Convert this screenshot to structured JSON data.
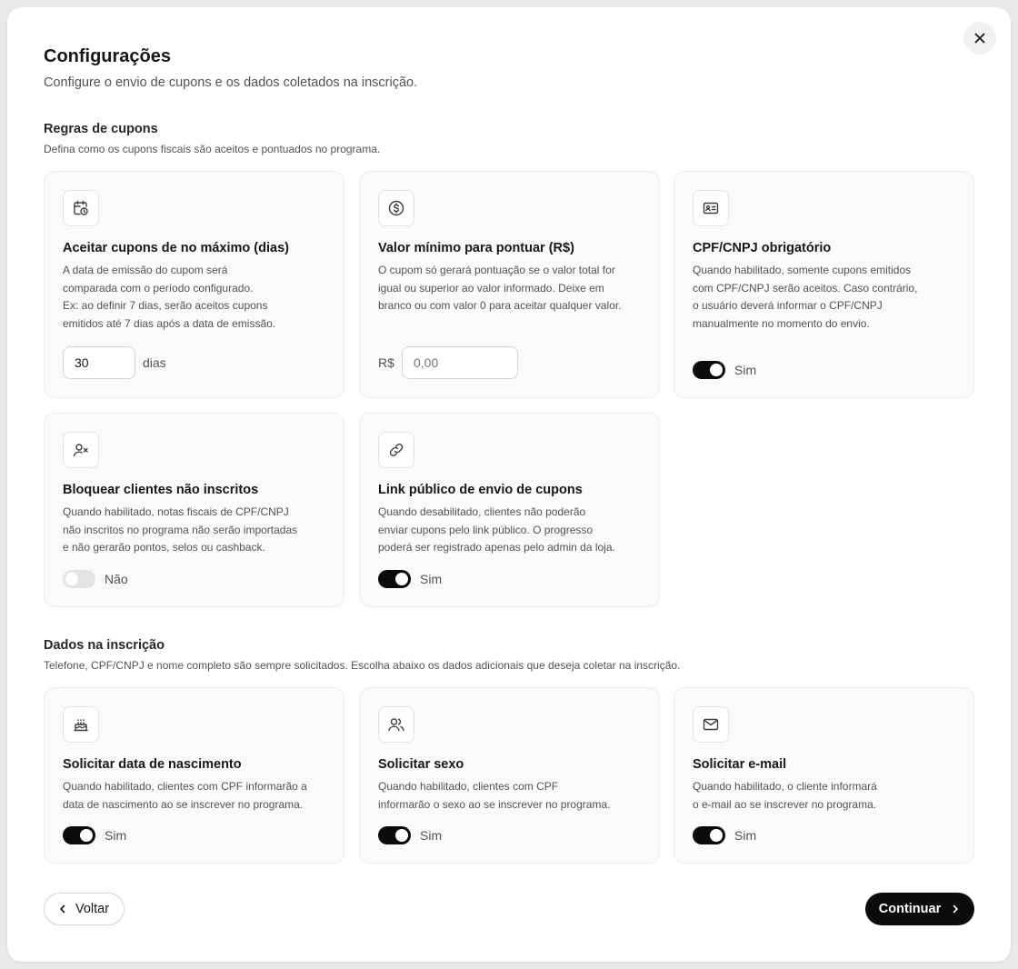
{
  "dialog": {
    "title": "Configurações",
    "subtitle": "Configure o envio de cupons e os dados coletados na inscrição."
  },
  "coupon_rules": {
    "title": "Regras de cupons",
    "description": "Defina como os cupons fiscais são aceitos e pontuados no programa.",
    "max_days": {
      "icon": "calendar-clock-icon",
      "title": "Aceitar cupons de no máximo (dias)",
      "description_lines": [
        "A data de emissão do cupom será",
        "comparada com o período configurado.",
        "Ex: ao definir 7 dias, serão aceitos cupons",
        "emitidos até 7 dias após a data de emissão."
      ],
      "value": "30",
      "unit": "dias"
    },
    "min_value": {
      "icon": "dollar-circle-icon",
      "title": "Valor mínimo para pontuar (R$)",
      "description_lines": [
        "O cupom só gerará pontuação se o valor total for",
        "igual ou superior ao valor informado. Deixe em",
        "branco ou com valor 0 para aceitar qualquer valor."
      ],
      "currency": "R$",
      "placeholder": "0,00"
    },
    "cpf_required": {
      "icon": "id-card-icon",
      "title": "CPF/CNPJ obrigatório",
      "description_lines": [
        "Quando habilitado, somente cupons emitidos",
        "com CPF/CNPJ serão aceitos. Caso contrário,",
        "o usuário deverá informar o CPF/CNPJ",
        "manualmente no momento do envio."
      ],
      "enabled": true,
      "toggle_label": "Sim"
    },
    "block_unregistered": {
      "icon": "user-x-icon",
      "title": "Bloquear clientes não inscritos",
      "description_lines": [
        "Quando habilitado, notas fiscais de CPF/CNPJ",
        "não inscritos no programa não serão importadas",
        "e não gerarão pontos, selos ou cashback."
      ],
      "enabled": false,
      "toggle_label": "Não"
    },
    "public_link": {
      "icon": "link-icon",
      "title": "Link público de envio de cupons",
      "description_lines": [
        "Quando desabilitado, clientes não poderão",
        "enviar cupons pelo link público. O progresso",
        "poderá ser registrado apenas pelo admin da loja."
      ],
      "enabled": true,
      "toggle_label": "Sim"
    }
  },
  "signup_data": {
    "title": "Dados na inscrição",
    "description": "Telefone, CPF/CNPJ e nome completo são sempre solicitados. Escolha abaixo os dados adicionais que deseja coletar na inscrição.",
    "birthdate": {
      "icon": "cake-icon",
      "title": "Solicitar data de nascimento",
      "description_lines": [
        "Quando habilitado, clientes com CPF informarão a",
        "data de nascimento ao se inscrever no programa."
      ],
      "enabled": true,
      "toggle_label": "Sim"
    },
    "gender": {
      "icon": "users-icon",
      "title": "Solicitar sexo",
      "description_lines": [
        "Quando habilitado, clientes com CPF",
        "informarão o sexo ao se inscrever no programa."
      ],
      "enabled": true,
      "toggle_label": "Sim"
    },
    "email": {
      "icon": "mail-icon",
      "title": "Solicitar e-mail",
      "description_lines": [
        "Quando habilitado, o cliente informará",
        "o e-mail ao se inscrever no programa."
      ],
      "enabled": true,
      "toggle_label": "Sim"
    }
  },
  "footer": {
    "back_label": "Voltar",
    "continue_label": "Continuar"
  }
}
